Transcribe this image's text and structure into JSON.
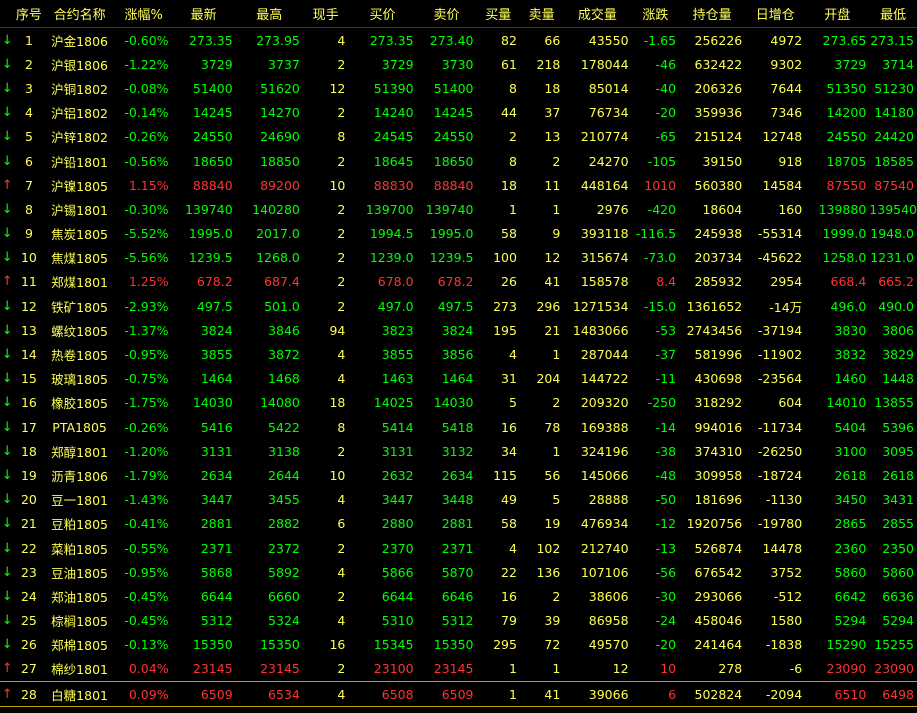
{
  "headers": [
    "序号",
    "合约名称",
    "涨幅%",
    "最新",
    "最高",
    "现手",
    "买价",
    "卖价",
    "买量",
    "卖量",
    "成交量",
    "涨跌",
    "持仓量",
    "日增仓",
    "开盘",
    "最低"
  ],
  "colors": {
    "up": "#ff3232",
    "down": "#00ff00",
    "neutral": "#ffff54",
    "background": "#000000"
  },
  "rows": [
    {
      "arrow": "↓",
      "dir": "down",
      "seq": "1",
      "name": "沪金1806",
      "pct": "-0.60%",
      "last": "273.35",
      "high": "273.95",
      "hand": "4",
      "bid": "273.35",
      "ask": "273.40",
      "bidv": "82",
      "askv": "66",
      "vol": "43550",
      "chg": "-1.65",
      "oi": "256226",
      "oichg": "4972",
      "open": "273.65",
      "low": "273.15"
    },
    {
      "arrow": "↓",
      "dir": "down",
      "seq": "2",
      "name": "沪银1806",
      "pct": "-1.22%",
      "last": "3729",
      "high": "3737",
      "hand": "2",
      "bid": "3729",
      "ask": "3730",
      "bidv": "61",
      "askv": "218",
      "vol": "178044",
      "chg": "-46",
      "oi": "632422",
      "oichg": "9302",
      "open": "3729",
      "low": "3714"
    },
    {
      "arrow": "↓",
      "dir": "down",
      "seq": "3",
      "name": "沪铜1802",
      "pct": "-0.08%",
      "last": "51400",
      "high": "51620",
      "hand": "12",
      "bid": "51390",
      "ask": "51400",
      "bidv": "8",
      "askv": "18",
      "vol": "85014",
      "chg": "-40",
      "oi": "206326",
      "oichg": "7644",
      "open": "51350",
      "low": "51230"
    },
    {
      "arrow": "↓",
      "dir": "down",
      "seq": "4",
      "name": "沪铝1802",
      "pct": "-0.14%",
      "last": "14245",
      "high": "14270",
      "hand": "2",
      "bid": "14240",
      "ask": "14245",
      "bidv": "44",
      "askv": "37",
      "vol": "76734",
      "chg": "-20",
      "oi": "359936",
      "oichg": "7346",
      "open": "14200",
      "low": "14180"
    },
    {
      "arrow": "↓",
      "dir": "down",
      "seq": "5",
      "name": "沪锌1802",
      "pct": "-0.26%",
      "last": "24550",
      "high": "24690",
      "hand": "8",
      "bid": "24545",
      "ask": "24550",
      "bidv": "2",
      "askv": "13",
      "vol": "210774",
      "chg": "-65",
      "oi": "215124",
      "oichg": "12748",
      "open": "24550",
      "low": "24420"
    },
    {
      "arrow": "↓",
      "dir": "down",
      "seq": "6",
      "name": "沪铅1801",
      "pct": "-0.56%",
      "last": "18650",
      "high": "18850",
      "hand": "2",
      "bid": "18645",
      "ask": "18650",
      "bidv": "8",
      "askv": "2",
      "vol": "24270",
      "chg": "-105",
      "oi": "39150",
      "oichg": "918",
      "open": "18705",
      "low": "18585"
    },
    {
      "arrow": "↑",
      "dir": "up",
      "seq": "7",
      "name": "沪镍1805",
      "pct": "1.15%",
      "last": "88840",
      "high": "89200",
      "hand": "10",
      "bid": "88830",
      "ask": "88840",
      "bidv": "18",
      "askv": "11",
      "vol": "448164",
      "chg": "1010",
      "oi": "560380",
      "oichg": "14584",
      "open": "87550",
      "low": "87540"
    },
    {
      "arrow": "↓",
      "dir": "down",
      "seq": "8",
      "name": "沪锡1801",
      "pct": "-0.30%",
      "last": "139740",
      "high": "140280",
      "hand": "2",
      "bid": "139700",
      "ask": "139740",
      "bidv": "1",
      "askv": "1",
      "vol": "2976",
      "chg": "-420",
      "oi": "18604",
      "oichg": "160",
      "open": "139880",
      "low": "139540"
    },
    {
      "arrow": "↓",
      "dir": "down",
      "seq": "9",
      "name": "焦炭1805",
      "pct": "-5.52%",
      "last": "1995.0",
      "high": "2017.0",
      "hand": "2",
      "bid": "1994.5",
      "ask": "1995.0",
      "bidv": "58",
      "askv": "9",
      "vol": "393118",
      "chg": "-116.5",
      "oi": "245938",
      "oichg": "-55314",
      "open": "1999.0",
      "low": "1948.0"
    },
    {
      "arrow": "↓",
      "dir": "down",
      "seq": "10",
      "name": "焦煤1805",
      "pct": "-5.56%",
      "last": "1239.5",
      "high": "1268.0",
      "hand": "2",
      "bid": "1239.0",
      "ask": "1239.5",
      "bidv": "100",
      "askv": "12",
      "vol": "315674",
      "chg": "-73.0",
      "oi": "203734",
      "oichg": "-45622",
      "open": "1258.0",
      "low": "1231.0"
    },
    {
      "arrow": "↑",
      "dir": "up",
      "seq": "11",
      "name": "郑煤1801",
      "pct": "1.25%",
      "last": "678.2",
      "high": "687.4",
      "hand": "2",
      "bid": "678.0",
      "ask": "678.2",
      "bidv": "26",
      "askv": "41",
      "vol": "158578",
      "chg": "8.4",
      "oi": "285932",
      "oichg": "2954",
      "open": "668.4",
      "low": "665.2"
    },
    {
      "arrow": "↓",
      "dir": "down",
      "seq": "12",
      "name": "铁矿1805",
      "pct": "-2.93%",
      "last": "497.5",
      "high": "501.0",
      "hand": "2",
      "bid": "497.0",
      "ask": "497.5",
      "bidv": "273",
      "askv": "296",
      "vol": "1271534",
      "chg": "-15.0",
      "oi": "1361652",
      "oichg": "-14万",
      "open": "496.0",
      "low": "490.0"
    },
    {
      "arrow": "↓",
      "dir": "down",
      "seq": "13",
      "name": "螺纹1805",
      "pct": "-1.37%",
      "last": "3824",
      "high": "3846",
      "hand": "94",
      "bid": "3823",
      "ask": "3824",
      "bidv": "195",
      "askv": "21",
      "vol": "1483066",
      "chg": "-53",
      "oi": "2743456",
      "oichg": "-37194",
      "open": "3830",
      "low": "3806"
    },
    {
      "arrow": "↓",
      "dir": "down",
      "seq": "14",
      "name": "热卷1805",
      "pct": "-0.95%",
      "last": "3855",
      "high": "3872",
      "hand": "4",
      "bid": "3855",
      "ask": "3856",
      "bidv": "4",
      "askv": "1",
      "vol": "287044",
      "chg": "-37",
      "oi": "581996",
      "oichg": "-11902",
      "open": "3832",
      "low": "3829"
    },
    {
      "arrow": "↓",
      "dir": "down",
      "seq": "15",
      "name": "玻璃1805",
      "pct": "-0.75%",
      "last": "1464",
      "high": "1468",
      "hand": "4",
      "bid": "1463",
      "ask": "1464",
      "bidv": "31",
      "askv": "204",
      "vol": "144722",
      "chg": "-11",
      "oi": "430698",
      "oichg": "-23564",
      "open": "1460",
      "low": "1448"
    },
    {
      "arrow": "↓",
      "dir": "down",
      "seq": "16",
      "name": "橡胶1805",
      "pct": "-1.75%",
      "last": "14030",
      "high": "14080",
      "hand": "18",
      "bid": "14025",
      "ask": "14030",
      "bidv": "5",
      "askv": "2",
      "vol": "209320",
      "chg": "-250",
      "oi": "318292",
      "oichg": "604",
      "open": "14010",
      "low": "13855"
    },
    {
      "arrow": "↓",
      "dir": "down",
      "seq": "17",
      "name": "PTA1805",
      "pct": "-0.26%",
      "last": "5416",
      "high": "5422",
      "hand": "8",
      "bid": "5414",
      "ask": "5418",
      "bidv": "16",
      "askv": "78",
      "vol": "169388",
      "chg": "-14",
      "oi": "994016",
      "oichg": "-11734",
      "open": "5404",
      "low": "5396"
    },
    {
      "arrow": "↓",
      "dir": "down",
      "seq": "18",
      "name": "郑醇1801",
      "pct": "-1.20%",
      "last": "3131",
      "high": "3138",
      "hand": "2",
      "bid": "3131",
      "ask": "3132",
      "bidv": "34",
      "askv": "1",
      "vol": "324196",
      "chg": "-38",
      "oi": "374310",
      "oichg": "-26250",
      "open": "3100",
      "low": "3095"
    },
    {
      "arrow": "↓",
      "dir": "down",
      "seq": "19",
      "name": "沥青1806",
      "pct": "-1.79%",
      "last": "2634",
      "high": "2644",
      "hand": "10",
      "bid": "2632",
      "ask": "2634",
      "bidv": "115",
      "askv": "56",
      "vol": "145066",
      "chg": "-48",
      "oi": "309958",
      "oichg": "-18724",
      "open": "2618",
      "low": "2618"
    },
    {
      "arrow": "↓",
      "dir": "down",
      "seq": "20",
      "name": "豆一1801",
      "pct": "-1.43%",
      "last": "3447",
      "high": "3455",
      "hand": "4",
      "bid": "3447",
      "ask": "3448",
      "bidv": "49",
      "askv": "5",
      "vol": "28888",
      "chg": "-50",
      "oi": "181696",
      "oichg": "-1130",
      "open": "3450",
      "low": "3431"
    },
    {
      "arrow": "↓",
      "dir": "down",
      "seq": "21",
      "name": "豆粕1805",
      "pct": "-0.41%",
      "last": "2881",
      "high": "2882",
      "hand": "6",
      "bid": "2880",
      "ask": "2881",
      "bidv": "58",
      "askv": "19",
      "vol": "476934",
      "chg": "-12",
      "oi": "1920756",
      "oichg": "-19780",
      "open": "2865",
      "low": "2855"
    },
    {
      "arrow": "↓",
      "dir": "down",
      "seq": "22",
      "name": "菜粕1805",
      "pct": "-0.55%",
      "last": "2371",
      "high": "2372",
      "hand": "2",
      "bid": "2370",
      "ask": "2371",
      "bidv": "4",
      "askv": "102",
      "vol": "212740",
      "chg": "-13",
      "oi": "526874",
      "oichg": "14478",
      "open": "2360",
      "low": "2350"
    },
    {
      "arrow": "↓",
      "dir": "down",
      "seq": "23",
      "name": "豆油1805",
      "pct": "-0.95%",
      "last": "5868",
      "high": "5892",
      "hand": "4",
      "bid": "5866",
      "ask": "5870",
      "bidv": "22",
      "askv": "136",
      "vol": "107106",
      "chg": "-56",
      "oi": "676542",
      "oichg": "3752",
      "open": "5860",
      "low": "5860"
    },
    {
      "arrow": "↓",
      "dir": "down",
      "seq": "24",
      "name": "郑油1805",
      "pct": "-0.45%",
      "last": "6644",
      "high": "6660",
      "hand": "2",
      "bid": "6644",
      "ask": "6646",
      "bidv": "16",
      "askv": "2",
      "vol": "38606",
      "chg": "-30",
      "oi": "293066",
      "oichg": "-512",
      "open": "6642",
      "low": "6636"
    },
    {
      "arrow": "↓",
      "dir": "down",
      "seq": "25",
      "name": "棕榈1805",
      "pct": "-0.45%",
      "last": "5312",
      "high": "5324",
      "hand": "4",
      "bid": "5310",
      "ask": "5312",
      "bidv": "79",
      "askv": "39",
      "vol": "86958",
      "chg": "-24",
      "oi": "458046",
      "oichg": "1580",
      "open": "5294",
      "low": "5294"
    },
    {
      "arrow": "↓",
      "dir": "down",
      "seq": "26",
      "name": "郑棉1805",
      "pct": "-0.13%",
      "last": "15350",
      "high": "15350",
      "hand": "16",
      "bid": "15345",
      "ask": "15350",
      "bidv": "295",
      "askv": "72",
      "vol": "49570",
      "chg": "-20",
      "oi": "241464",
      "oichg": "-1838",
      "open": "15290",
      "low": "15255"
    },
    {
      "arrow": "↑",
      "dir": "up",
      "seq": "27",
      "name": "棉纱1801",
      "pct": "0.04%",
      "last": "23145",
      "high": "23145",
      "hand": "2",
      "bid": "23100",
      "ask": "23145",
      "bidv": "1",
      "askv": "1",
      "vol": "12",
      "chg": "10",
      "oi": "278",
      "oichg": "-6",
      "open": "23090",
      "low": "23090"
    },
    {
      "arrow": "↑",
      "dir": "up",
      "seq": "28",
      "name": "白糖1801",
      "pct": "0.09%",
      "last": "6509",
      "high": "6534",
      "hand": "4",
      "bid": "6508",
      "ask": "6509",
      "bidv": "1",
      "askv": "41",
      "vol": "39066",
      "chg": "6",
      "oi": "502824",
      "oichg": "-2094",
      "open": "6510",
      "low": "6498"
    }
  ]
}
